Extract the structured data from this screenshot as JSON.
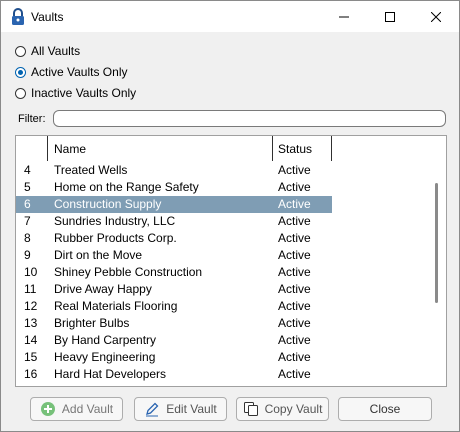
{
  "window": {
    "title": "Vaults"
  },
  "filters": {
    "options": [
      {
        "label": "All Vaults",
        "checked": false
      },
      {
        "label": "Active Vaults Only",
        "checked": true
      },
      {
        "label": "Inactive Vaults Only",
        "checked": false
      }
    ]
  },
  "filter": {
    "label": "Filter:",
    "value": ""
  },
  "grid": {
    "columns": {
      "name": "Name",
      "status": "Status"
    },
    "rows": [
      {
        "id": "4",
        "name": "Treated Wells",
        "status": "Active"
      },
      {
        "id": "5",
        "name": "Home on the Range Safety",
        "status": "Active"
      },
      {
        "id": "6",
        "name": "Construction Supply",
        "status": "Active"
      },
      {
        "id": "7",
        "name": "Sundries Industry, LLC",
        "status": "Active"
      },
      {
        "id": "8",
        "name": "Rubber Products Corp.",
        "status": "Active"
      },
      {
        "id": "9",
        "name": "Dirt on the Move",
        "status": "Active"
      },
      {
        "id": "10",
        "name": "Shiney Pebble Construction",
        "status": "Active"
      },
      {
        "id": "11",
        "name": "Drive Away Happy",
        "status": "Active"
      },
      {
        "id": "12",
        "name": "Real Materials Flooring",
        "status": "Active"
      },
      {
        "id": "13",
        "name": "Brighter Bulbs",
        "status": "Active"
      },
      {
        "id": "14",
        "name": "By Hand Carpentry",
        "status": "Active"
      },
      {
        "id": "15",
        "name": "Heavy Engineering",
        "status": "Active"
      },
      {
        "id": "16",
        "name": "Hard Hat Developers",
        "status": "Active"
      }
    ],
    "selected_row_id": "6"
  },
  "buttons": {
    "add": "Add Vault",
    "edit": "Edit Vault",
    "copy": "Copy Vault",
    "close": "Close"
  },
  "colors": {
    "selection": "#7f9db4",
    "accent": "#0063b1",
    "add_icon": "#4caf50"
  }
}
